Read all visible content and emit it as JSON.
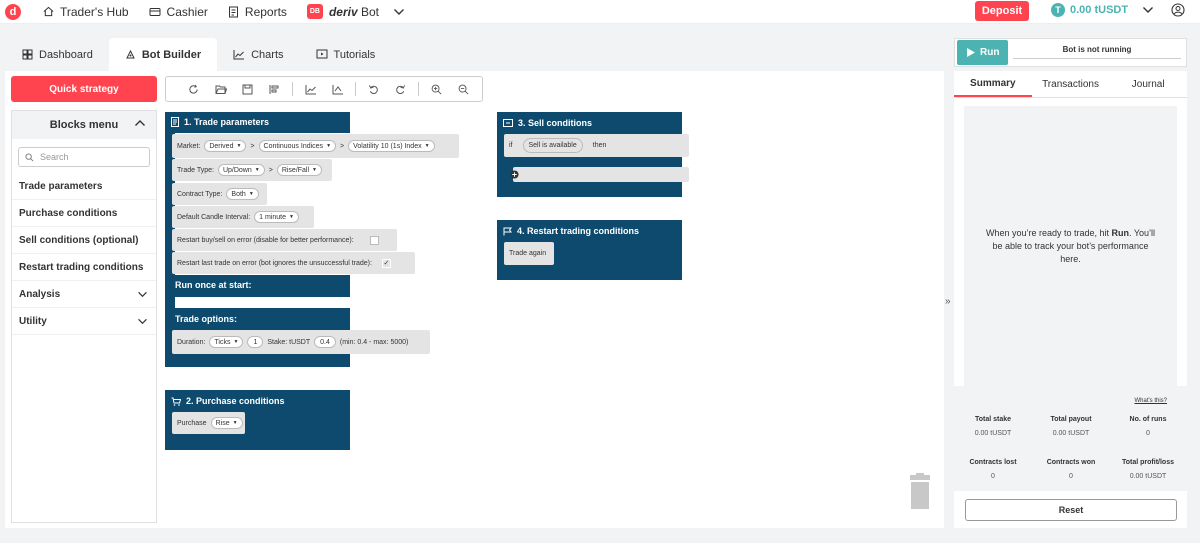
{
  "topbar": {
    "traders_hub": "Trader's Hub",
    "cashier": "Cashier",
    "reports": "Reports",
    "brand_badge": "DB",
    "brand_name": "deriv",
    "brand_suffix": "Bot",
    "deposit": "Deposit",
    "balance": "0.00 tUSDT",
    "currency_icon": "T"
  },
  "tabs": [
    {
      "label": "Dashboard",
      "icon": "dashboard-icon"
    },
    {
      "label": "Bot Builder",
      "icon": "bot-builder-icon"
    },
    {
      "label": "Charts",
      "icon": "charts-icon"
    },
    {
      "label": "Tutorials",
      "icon": "tutorials-icon"
    }
  ],
  "left_menu": {
    "quick_strategy": "Quick strategy",
    "blocks_menu": "Blocks menu",
    "search_placeholder": "Search",
    "items": [
      "Trade parameters",
      "Purchase conditions",
      "Sell conditions (optional)",
      "Restart trading conditions"
    ],
    "expandable": [
      "Analysis",
      "Utility"
    ]
  },
  "blocks": {
    "trade_params": {
      "title": "1. Trade parameters",
      "market_label": "Market:",
      "market": "Derived",
      "submarket": "Continuous Indices",
      "symbol": "Volatility 10 (1s) Index",
      "trade_type_label": "Trade Type:",
      "trade_type": "Up/Down",
      "trade_subtype": "Rise/Fall",
      "contract_type_label": "Contract Type:",
      "contract_type": "Both",
      "candle_label": "Default Candle Interval:",
      "candle": "1 minute",
      "restart_error_label": "Restart buy/sell on error (disable for better performance):",
      "restart_last_label": "Restart last trade on error (bot ignores the unsuccessful trade):",
      "run_once": "Run once at start:",
      "trade_options": "Trade options:",
      "duration_label": "Duration:",
      "duration_unit": "Ticks",
      "duration_value": "1",
      "stake_label": "Stake: tUSDT",
      "stake_value": "0.4",
      "stake_limits": "(min: 0.4 - max: 5000)"
    },
    "purchase": {
      "title": "2. Purchase conditions",
      "label": "Purchase",
      "value": "Rise"
    },
    "sell": {
      "title": "3. Sell conditions",
      "if": "if",
      "condition": "Sell is available",
      "then": "then"
    },
    "restart": {
      "title": "4. Restart trading conditions",
      "label": "Trade again"
    }
  },
  "right": {
    "run": "Run",
    "status": "Bot is not running",
    "tabs": [
      "Summary",
      "Transactions",
      "Journal"
    ],
    "empty_line1": "When you’re ready to trade, hit ",
    "empty_run": "Run",
    "empty_line2": ". You’ll be able to track your bot’s performance here.",
    "whats_this": "What's this?",
    "stats": [
      {
        "label": "Total stake",
        "value": "0.00 tUSDT"
      },
      {
        "label": "Total payout",
        "value": "0.00 tUSDT"
      },
      {
        "label": "No. of runs",
        "value": "0"
      },
      {
        "label": "Contracts lost",
        "value": "0"
      },
      {
        "label": "Contracts won",
        "value": "0"
      },
      {
        "label": "Total profit/loss",
        "value": "0.00 tUSDT"
      }
    ],
    "reset": "Reset"
  },
  "colors": {
    "brand_red": "#ff444f",
    "teal": "#4bb4b3",
    "block_blue": "#0e4a6d"
  }
}
